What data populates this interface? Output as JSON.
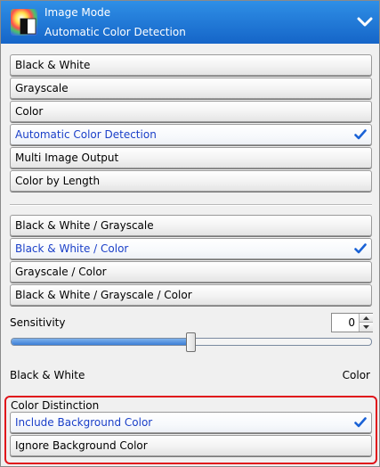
{
  "header": {
    "title": "Image Mode",
    "subtitle": "Automatic Color Detection",
    "collapse_icon": "chevron-down-icon"
  },
  "image_mode_options": [
    {
      "label": "Black & White",
      "selected": false
    },
    {
      "label": "Grayscale",
      "selected": false
    },
    {
      "label": "Color",
      "selected": false
    },
    {
      "label": "Automatic Color Detection",
      "selected": true
    },
    {
      "label": "Multi Image Output",
      "selected": false
    },
    {
      "label": "Color by Length",
      "selected": false
    }
  ],
  "detection_options": [
    {
      "label": "Black & White / Grayscale",
      "selected": false
    },
    {
      "label": "Black & White / Color",
      "selected": true
    },
    {
      "label": "Grayscale / Color",
      "selected": false
    },
    {
      "label": "Black & White / Grayscale / Color",
      "selected": false
    }
  ],
  "sensitivity": {
    "label": "Sensitivity",
    "value": "0",
    "slider_fraction": 0.5,
    "min_label": "Black & White",
    "max_label": "Color"
  },
  "color_distinction": {
    "title": "Color Distinction",
    "options": [
      {
        "label": "Include Background Color",
        "selected": true
      },
      {
        "label": "Ignore Background Color",
        "selected": false
      }
    ]
  },
  "colors": {
    "header_start": "#2f8fe6",
    "header_end": "#1565c8",
    "selected_text": "#1a3fc8",
    "check": "#1a62d6",
    "highlight_border": "#e0141b"
  }
}
